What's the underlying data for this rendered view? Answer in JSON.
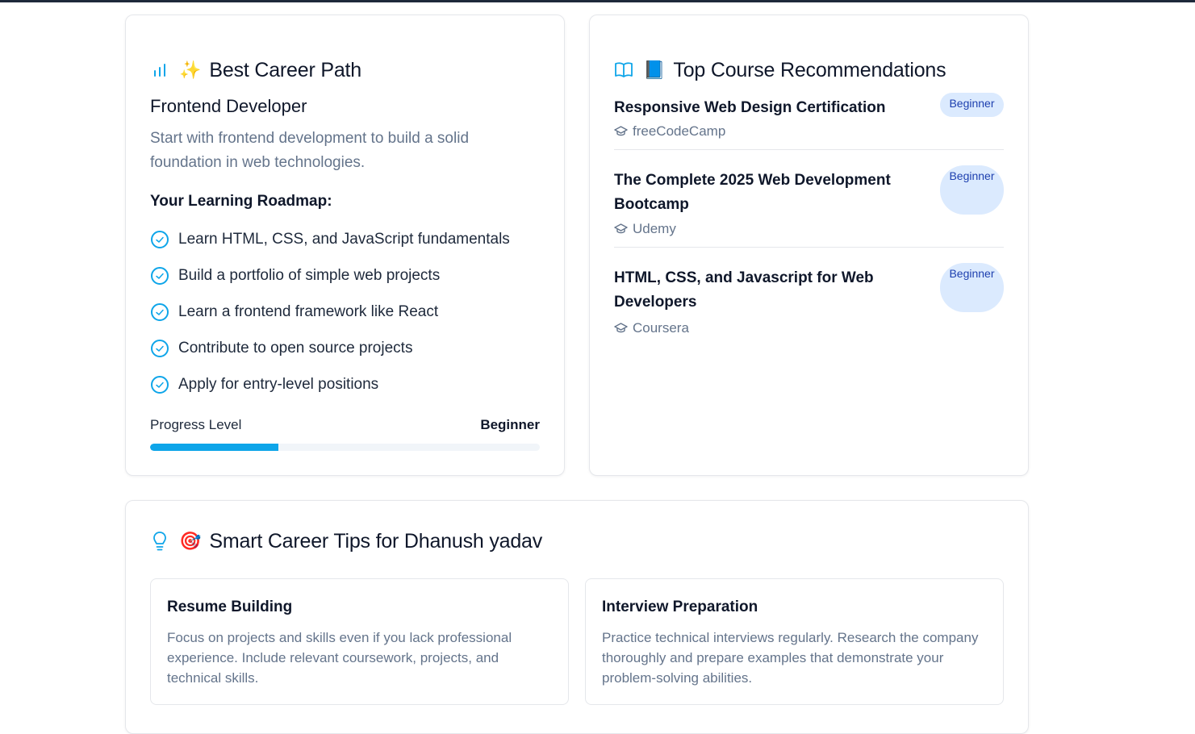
{
  "career": {
    "heading_emoji": "✨",
    "heading": "Best Career Path",
    "path_title": "Frontend Developer",
    "path_description": "Start with frontend development to build a solid foundation in web technologies.",
    "roadmap_title": "Your Learning Roadmap:",
    "roadmap": [
      "Learn HTML, CSS, and JavaScript fundamentals",
      "Build a portfolio of simple web projects",
      "Learn a frontend framework like React",
      "Contribute to open source projects",
      "Apply for entry-level positions"
    ],
    "progress_label": "Progress Level",
    "progress_value": "Beginner",
    "progress_fraction": 0.33
  },
  "courses": {
    "heading_emoji": "📘",
    "heading": "Top Course Recommendations",
    "items": [
      {
        "title": "Responsive Web Design Certification",
        "level": "Beginner",
        "provider": "freeCodeCamp"
      },
      {
        "title": "The Complete 2025 Web Development Bootcamp",
        "level": "Beginner",
        "provider": "Udemy"
      },
      {
        "title": "HTML, CSS, and Javascript for Web Developers",
        "level": "Beginner",
        "provider": "Coursera"
      }
    ]
  },
  "tips": {
    "heading_emoji": "🎯",
    "heading": "Smart Career Tips for Dhanush yadav",
    "items": [
      {
        "title": "Resume Building",
        "text": "Focus on projects and skills even if you lack professional experience. Include relevant coursework, projects, and technical skills."
      },
      {
        "title": "Interview Preparation",
        "text": "Practice technical interviews regularly. Research the company thoroughly and prepare examples that demonstrate your problem-solving abilities."
      }
    ]
  },
  "colors": {
    "accent": "#0ea5e9",
    "badge_bg": "#dbeafe",
    "badge_text": "#1e40af",
    "muted_text": "#64748b"
  },
  "icons": {
    "career": "bar-chart-icon",
    "courses": "book-open-icon",
    "tips": "lightbulb-icon",
    "roadmap_item": "check-circle-icon",
    "provider": "graduation-cap-icon"
  }
}
